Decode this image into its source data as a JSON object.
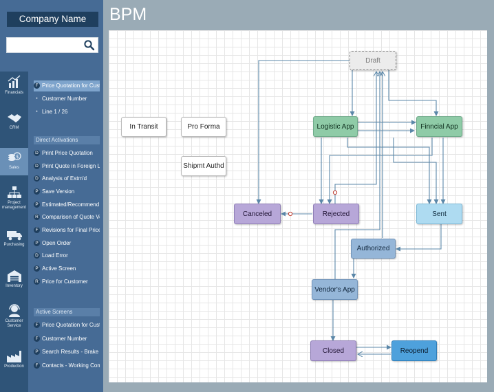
{
  "brand": {
    "company_name": "Company Name"
  },
  "search": {
    "value": "",
    "placeholder": ""
  },
  "page": {
    "title": "BPM"
  },
  "rail": [
    {
      "label": "Financials",
      "icon": "chart-up-icon"
    },
    {
      "label": "CRM",
      "icon": "handshake-icon"
    },
    {
      "label": "Sales",
      "icon": "coins-icon"
    },
    {
      "label": "Project management",
      "icon": "hierarchy-icon"
    },
    {
      "label": "Purchasing",
      "icon": "truck-icon"
    },
    {
      "label": "Inventory",
      "icon": "warehouse-icon"
    },
    {
      "label": "Customer Service",
      "icon": "headset-icon"
    },
    {
      "label": "Production",
      "icon": "factory-icon"
    }
  ],
  "top_items": [
    {
      "badge": "F",
      "label": "Price Quotation for Cust"
    },
    {
      "badge": "",
      "label": "Customer Number"
    },
    {
      "badge": "",
      "label": "Line 1 / 26"
    }
  ],
  "direct_activations": {
    "title": "Direct Activations",
    "items": [
      {
        "badge": "D",
        "label": "Print Price Quotation"
      },
      {
        "badge": "D",
        "label": "Print Quote in Foreign Lan"
      },
      {
        "badge": "D",
        "label": "Analysis of Estm'd"
      },
      {
        "badge": "P",
        "label": "Save Version"
      },
      {
        "badge": "P",
        "label": "Estimated/Recommend V"
      },
      {
        "badge": "R",
        "label": "Comparison of Quote Ver"
      },
      {
        "badge": "F",
        "label": "Revisions for Final Price"
      },
      {
        "badge": "P",
        "label": "Open Order"
      },
      {
        "badge": "D",
        "label": "Load Error"
      },
      {
        "badge": "P",
        "label": "Active Screen"
      },
      {
        "badge": "R",
        "label": "Price for Customer"
      }
    ]
  },
  "active_screens": {
    "title": "Active Screens",
    "items": [
      {
        "badge": "F",
        "label": "Price Quotation for Cust"
      },
      {
        "badge": "F",
        "label": "Customer Number"
      },
      {
        "badge": "P",
        "label": "Search Results - Brake P"
      },
      {
        "badge": "F",
        "label": "Contacts - Working Com"
      }
    ]
  },
  "nodes": {
    "draft": "Draft",
    "in_transit": "In Transit",
    "pro_forma": "Pro Forma",
    "shipmt_authd": "Shipmt Authd",
    "logistic_app": "Logistic App",
    "finncial_app": "Finncial App",
    "canceled": "Canceled",
    "rejected": "Rejected",
    "sent": "Sent",
    "authorized": "Authorized",
    "vendors_app": "Vendor's App",
    "closed": "Closed",
    "reopend": "Reopend"
  },
  "colors": {
    "rail_bg": "#2f5478",
    "menu_bg": "#466b95",
    "brand_bg": "#1f3f5e",
    "connector": "#5b87a8",
    "green_node": "#8fcba7",
    "purple_node": "#b7a7d8",
    "light_blue_node": "#aedbf1",
    "steel_node": "#95b6d8",
    "blue_node": "#4ea1dc"
  }
}
